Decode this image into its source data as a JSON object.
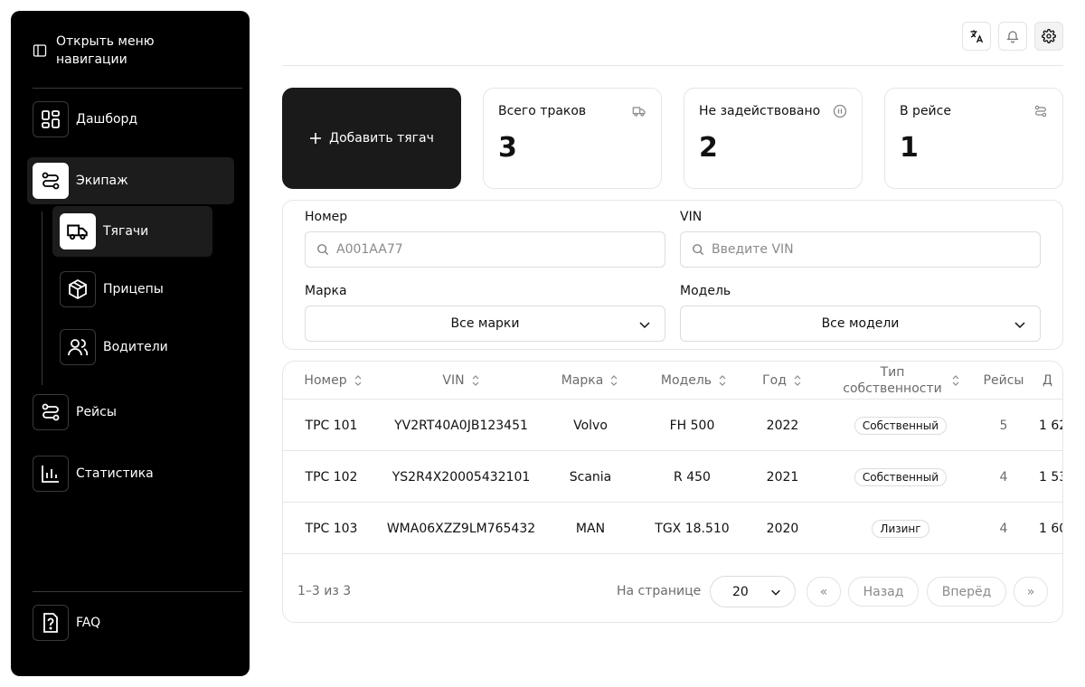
{
  "sidebar": {
    "toggle_label": "Открыть меню навигации",
    "items": [
      {
        "label": "Дашборд",
        "icon": "dashboard-icon"
      },
      {
        "label": "Экипаж",
        "icon": "route-icon"
      },
      {
        "label": "Тягачи",
        "icon": "truck-icon"
      },
      {
        "label": "Прицепы",
        "icon": "box-icon"
      },
      {
        "label": "Водители",
        "icon": "users-icon"
      },
      {
        "label": "Рейсы",
        "icon": "route-icon"
      },
      {
        "label": "Статистика",
        "icon": "bar-chart-icon"
      }
    ],
    "faq_label": "FAQ"
  },
  "topbar": {
    "icons": [
      "translate-icon",
      "bell-icon",
      "gear-icon"
    ]
  },
  "actions": {
    "add_label": "Добавить тягач"
  },
  "stats": [
    {
      "label": "Всего траков",
      "value": "3",
      "icon": "truck-icon"
    },
    {
      "label": "Не задействовано",
      "value": "2",
      "icon": "pause-icon"
    },
    {
      "label": "В рейсе",
      "value": "1",
      "icon": "route-icon"
    }
  ],
  "filters": {
    "number_label": "Номер",
    "number_placeholder": "A001AA77",
    "vin_label": "VIN",
    "vin_placeholder": "Введите VIN",
    "brand_label": "Марка",
    "brand_value": "Все марки",
    "model_label": "Модель",
    "model_value": "Все модели"
  },
  "table": {
    "columns": [
      "Номер",
      "VIN",
      "Марка",
      "Модель",
      "Год",
      "Тип собственности",
      "Рейсы",
      "Д"
    ],
    "rows": [
      {
        "number": "ТРС 101",
        "vin": "YV2RT40A0JB123451",
        "brand": "Volvo",
        "model": "FH 500",
        "year": "2022",
        "ownership": "Собственный",
        "trips": "5",
        "extra": "1 62"
      },
      {
        "number": "ТРС 102",
        "vin": "YS2R4X20005432101",
        "brand": "Scania",
        "model": "R 450",
        "year": "2021",
        "ownership": "Собственный",
        "trips": "4",
        "extra": "1 53"
      },
      {
        "number": "ТРС 103",
        "vin": "WMA06XZZ9LM765432",
        "brand": "MAN",
        "model": "TGX 18.510",
        "year": "2020",
        "ownership": "Лизинг",
        "trips": "4",
        "extra": "1 60"
      }
    ]
  },
  "pagination": {
    "range": "1–3 из 3",
    "per_page_label": "На странице",
    "per_page_value": "20",
    "first": "«",
    "prev": "Назад",
    "next": "Вперёд",
    "last": "»"
  }
}
